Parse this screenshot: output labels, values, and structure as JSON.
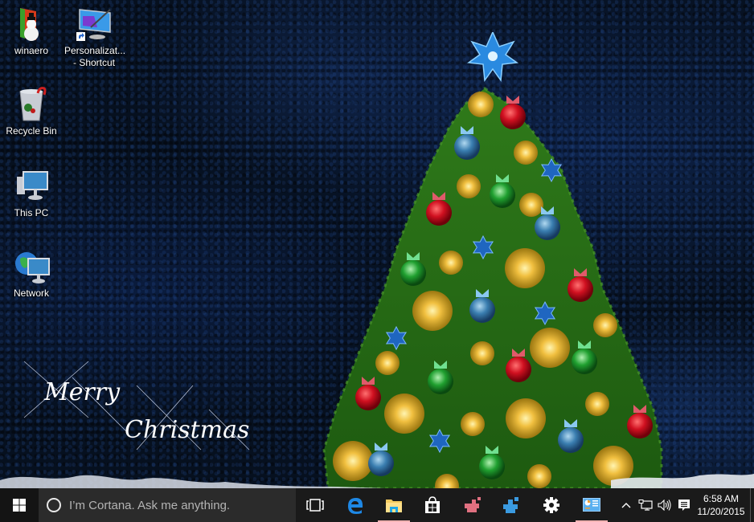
{
  "desktop": {
    "wallpaper": "Christmas tree on dark blue background",
    "greeting": {
      "line1": "Merry",
      "line2": "Christmas"
    },
    "icons": [
      {
        "label": "winaero",
        "icon": "folder-snowman-icon"
      },
      {
        "label": "Personalizat...",
        "label2": "- Shortcut",
        "icon": "personalization-shortcut-icon"
      },
      {
        "label": "Recycle Bin",
        "icon": "recycle-bin-icon"
      },
      {
        "label": "This PC",
        "icon": "this-pc-icon"
      },
      {
        "label": "Network",
        "icon": "network-icon"
      }
    ]
  },
  "taskbar": {
    "start_icon": "windows-logo-icon",
    "cortana_placeholder": "I’m Cortana. Ask me anything.",
    "apps": [
      {
        "name": "Task View",
        "icon": "task-view-icon",
        "running": false
      },
      {
        "name": "Microsoft Edge",
        "icon": "edge-icon",
        "running": false
      },
      {
        "name": "File Explorer",
        "icon": "file-explorer-icon",
        "running": true
      },
      {
        "name": "Store",
        "icon": "store-icon",
        "running": false
      },
      {
        "name": "Registry Editor (red)",
        "icon": "registry-red-icon",
        "running": false
      },
      {
        "name": "Registry Editor",
        "icon": "registry-blue-icon",
        "running": false
      },
      {
        "name": "Settings",
        "icon": "gear-icon",
        "running": false
      },
      {
        "name": "Control Panel",
        "icon": "control-panel-icon",
        "running": true
      }
    ],
    "tray": {
      "time": "6:58 AM",
      "date": "11/20/2015",
      "icons": [
        "chevron-up-icon",
        "network-tray-icon",
        "volume-icon",
        "action-center-icon"
      ]
    },
    "colors": {
      "background": "#1a1a1a",
      "cortana_bg": "#2b2b2b",
      "running_indicator": "#f3b3b3"
    }
  }
}
